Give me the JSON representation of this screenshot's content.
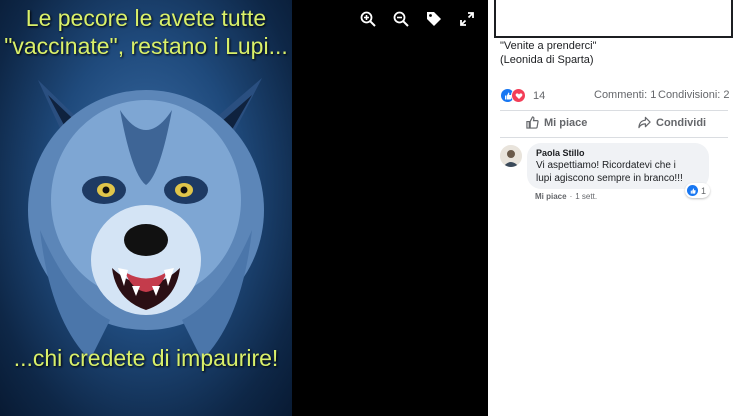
{
  "image": {
    "caption_top": "Le pecore le avete tutte \"vaccinate\", restano i Lupi...",
    "caption_bottom": "...chi credete di impaurire!"
  },
  "viewer_toolbar": {
    "icons": [
      "zoom-in-icon",
      "zoom-out-icon",
      "tag-icon",
      "fullscreen-icon"
    ]
  },
  "post": {
    "text_line1": "\"Venite a prenderci\"",
    "text_line2": "(Leonida di Sparta)",
    "reaction_count": "14",
    "comments_label": "Commenti: 1",
    "shares_label": "Condivisioni: 2",
    "like_label": "Mi piace",
    "share_label": "Condividi"
  },
  "comment": {
    "author": "Paola Stillo",
    "text_line1": "Vi aspettiamo! Ricordatevi che i",
    "text_line2": "lupi agiscono sempre in branco!!!",
    "reaction_count": "1",
    "like_link": "Mi piace",
    "separator": "·",
    "time": "1 sett."
  },
  "colors": {
    "caption": "#d9f06a",
    "like_blue": "#1877f2",
    "love_red": "#f33e58",
    "muted_text": "#65676b"
  }
}
